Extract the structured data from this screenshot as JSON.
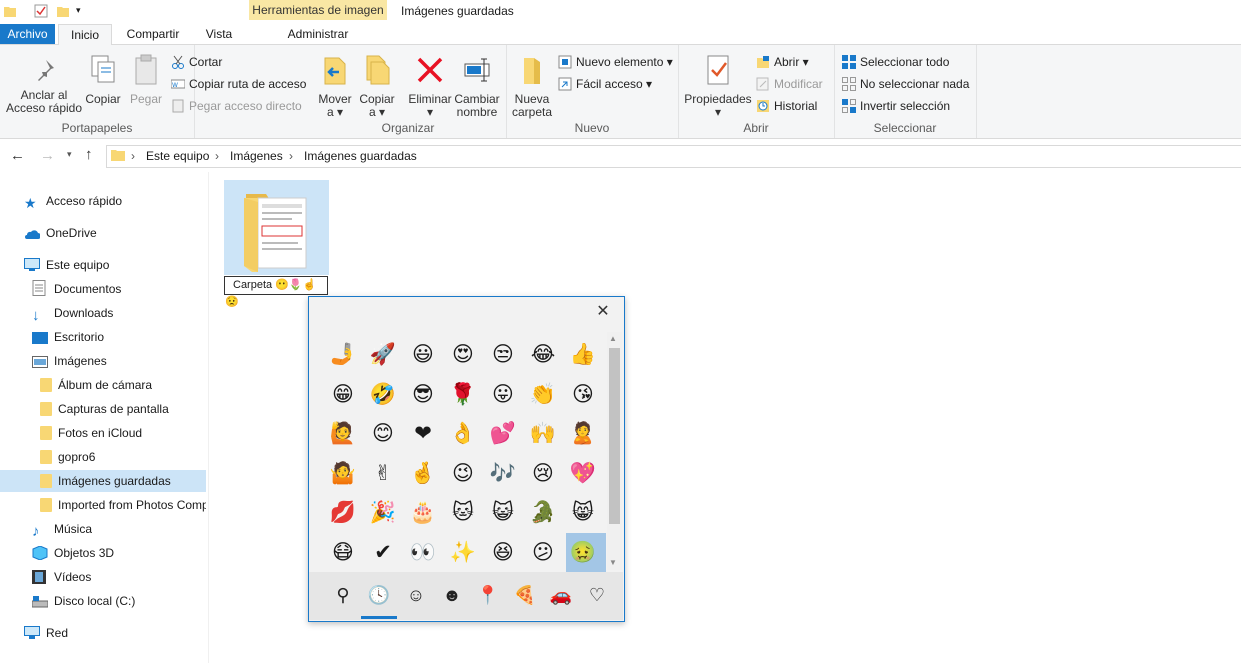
{
  "titlebar": {
    "context_tab": "Herramientas de imagen",
    "context_sub": "Administrar",
    "title": "Imágenes guardadas"
  },
  "tabs": [
    "Archivo",
    "Inicio",
    "Compartir",
    "Vista"
  ],
  "ribbon": {
    "portapapeles": {
      "label": "Portapapeles",
      "anclar": "Anclar al\nAcceso rápido",
      "copiar": "Copiar",
      "pegar": "Pegar",
      "cortar": "Cortar",
      "copiar_ruta": "Copiar ruta de acceso",
      "pegar_acceso": "Pegar acceso directo"
    },
    "organizar": {
      "label": "Organizar",
      "mover": "Mover\na ▾",
      "copiar_a": "Copiar\na ▾",
      "eliminar": "Eliminar\n▾",
      "cambiar": "Cambiar\nnombre"
    },
    "nuevo": {
      "label": "Nuevo",
      "nueva_carpeta": "Nueva\ncarpeta",
      "nuevo_elemento": "Nuevo elemento ▾",
      "facil_acceso": "Fácil acceso ▾"
    },
    "abrir": {
      "label": "Abrir",
      "propiedades": "Propiedades\n▾",
      "abrir": "Abrir ▾",
      "modificar": "Modificar",
      "historial": "Historial"
    },
    "seleccionar": {
      "label": "Seleccionar",
      "todo": "Seleccionar todo",
      "nada": "No seleccionar nada",
      "invertir": "Invertir selección"
    }
  },
  "address": {
    "crumbs": [
      "Este equipo",
      "Imágenes",
      "Imágenes guardadas"
    ]
  },
  "nav": {
    "acceso_rapido": "Acceso rápido",
    "onedrive": "OneDrive",
    "este_equipo": "Este equipo",
    "documentos": "Documentos",
    "downloads": "Downloads",
    "escritorio": "Escritorio",
    "imagenes": "Imágenes",
    "album": "Álbum de cámara",
    "capturas": "Capturas de pantalla",
    "icloud": "Fotos en iCloud",
    "gopro": "gopro6",
    "guardadas": "Imágenes guardadas",
    "imported": "Imported from Photos Companion",
    "musica": "Música",
    "objetos": "Objetos 3D",
    "videos": "Vídeos",
    "disco": "Disco local (C:)",
    "red": "Red"
  },
  "content": {
    "rename_value": "Carpeta 😶🌷☝😟"
  },
  "emoji_panel": {
    "close": "✕",
    "emojis": [
      "🤳",
      "🚀",
      "😃",
      "😍",
      "😒",
      "😂",
      "👍",
      "😁",
      "🤣",
      "😎",
      "🌹",
      "😛",
      "👏",
      "😘",
      "🙋",
      "😊",
      "❤",
      "👌",
      "💕",
      "🙌",
      "🙎",
      "🤷",
      "✌",
      "🤞",
      "😉",
      "🎶",
      "😢",
      "💖",
      "💋",
      "🎉",
      "🎂",
      "🐱",
      "😺",
      "🐊",
      "😸",
      "😷",
      "✔",
      "👀",
      "✨",
      "😆",
      "😕",
      "🤢"
    ],
    "tabs": [
      "search-icon",
      "recent-icon",
      "smiley-icon",
      "people-icon",
      "place-icon",
      "food-icon",
      "travel-icon",
      "heart-icon"
    ],
    "tab_glyphs": [
      "⚲",
      "🕓",
      "☺",
      "☻",
      "📍",
      "🍕",
      "🚗",
      "♡"
    ]
  },
  "colors": {
    "accent": "#1979ca",
    "selection": "#cce4f7",
    "context_tab": "#f9e7a4",
    "delete_red": "#e81123"
  }
}
